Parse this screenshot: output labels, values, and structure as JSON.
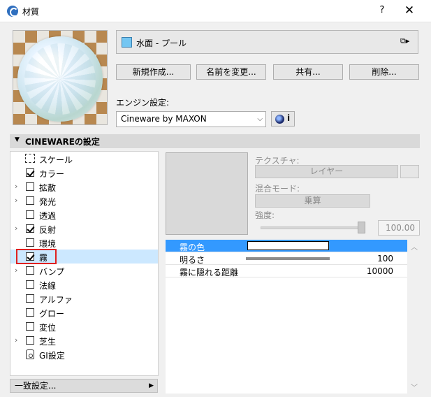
{
  "window": {
    "title": "材質",
    "help": "?",
    "close": "✕"
  },
  "material": {
    "name": "水面 - プール",
    "swatch_color": "#74c6f2",
    "menu_icon": "⧉▸"
  },
  "buttons": {
    "new": "新規作成...",
    "rename": "名前を変更...",
    "share": "共有...",
    "delete": "削除..."
  },
  "engine": {
    "label": "エンジン設定:",
    "value": "Cineware by MAXON",
    "info": "i"
  },
  "section": {
    "title": "CINEWAREの設定"
  },
  "channels": [
    {
      "label": "スケール",
      "has_checkbox": false,
      "checked": false,
      "expandable": false,
      "icon": "scale-icon"
    },
    {
      "label": "カラー",
      "has_checkbox": true,
      "checked": true,
      "expandable": false
    },
    {
      "label": "拡散",
      "has_checkbox": true,
      "checked": false,
      "expandable": true
    },
    {
      "label": "発光",
      "has_checkbox": true,
      "checked": false,
      "expandable": true
    },
    {
      "label": "透過",
      "has_checkbox": true,
      "checked": false,
      "expandable": false
    },
    {
      "label": "反射",
      "has_checkbox": true,
      "checked": true,
      "expandable": true
    },
    {
      "label": "環境",
      "has_checkbox": true,
      "checked": false,
      "expandable": false
    },
    {
      "label": "霧",
      "has_checkbox": true,
      "checked": true,
      "expandable": false,
      "selected": true
    },
    {
      "label": "バンプ",
      "has_checkbox": true,
      "checked": false,
      "expandable": true
    },
    {
      "label": "法線",
      "has_checkbox": true,
      "checked": false,
      "expandable": false
    },
    {
      "label": "アルファ",
      "has_checkbox": true,
      "checked": false,
      "expandable": false
    },
    {
      "label": "グロー",
      "has_checkbox": true,
      "checked": false,
      "expandable": false
    },
    {
      "label": "変位",
      "has_checkbox": true,
      "checked": false,
      "expandable": false
    },
    {
      "label": "芝生",
      "has_checkbox": true,
      "checked": false,
      "expandable": true
    },
    {
      "label": "GI設定",
      "has_checkbox": false,
      "checked": false,
      "expandable": false,
      "icon": "gi-settings-icon"
    }
  ],
  "consistent": {
    "label": "一致設定..."
  },
  "texture": {
    "label": "テクスチャ:",
    "layer_button": "レイヤー",
    "blend_label": "混合モード:",
    "blend_value": "乗算",
    "strength_label": "強度:",
    "strength_value": "100.00",
    "strength_level": 1.0
  },
  "params": [
    {
      "label": "霧の色",
      "value": "",
      "color": "#ffffff",
      "selected": true
    },
    {
      "label": "明るさ",
      "value": "100",
      "level": 1.0
    },
    {
      "label": "霧に隠れる距離",
      "value": "10000"
    }
  ]
}
